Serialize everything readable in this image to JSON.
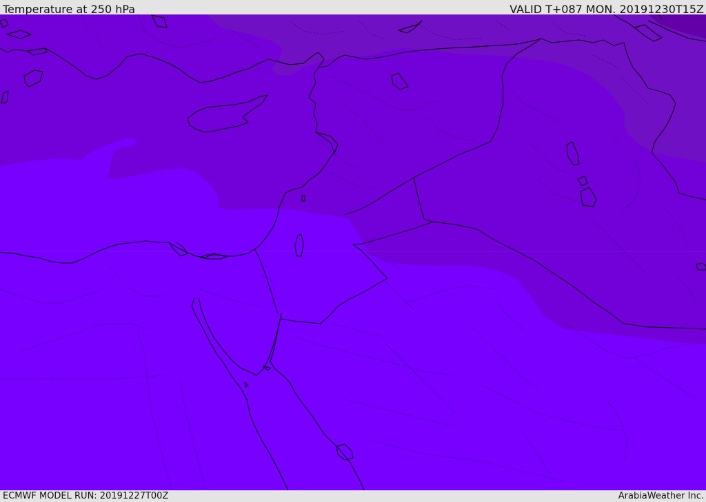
{
  "header": {
    "title": "Temperature at 250 hPa",
    "valid": "VALID T+087 MON. 20191230T15Z"
  },
  "footer": {
    "model_run": "ECMWF MODEL RUN: 20191227T00Z",
    "credit": "ArabiaWeather Inc."
  },
  "legend_colors": {
    "warmest_band": "#7700ff",
    "band_2": "#7200d8",
    "band_3": "#7010c4",
    "coldest_band": "#6400a8"
  }
}
